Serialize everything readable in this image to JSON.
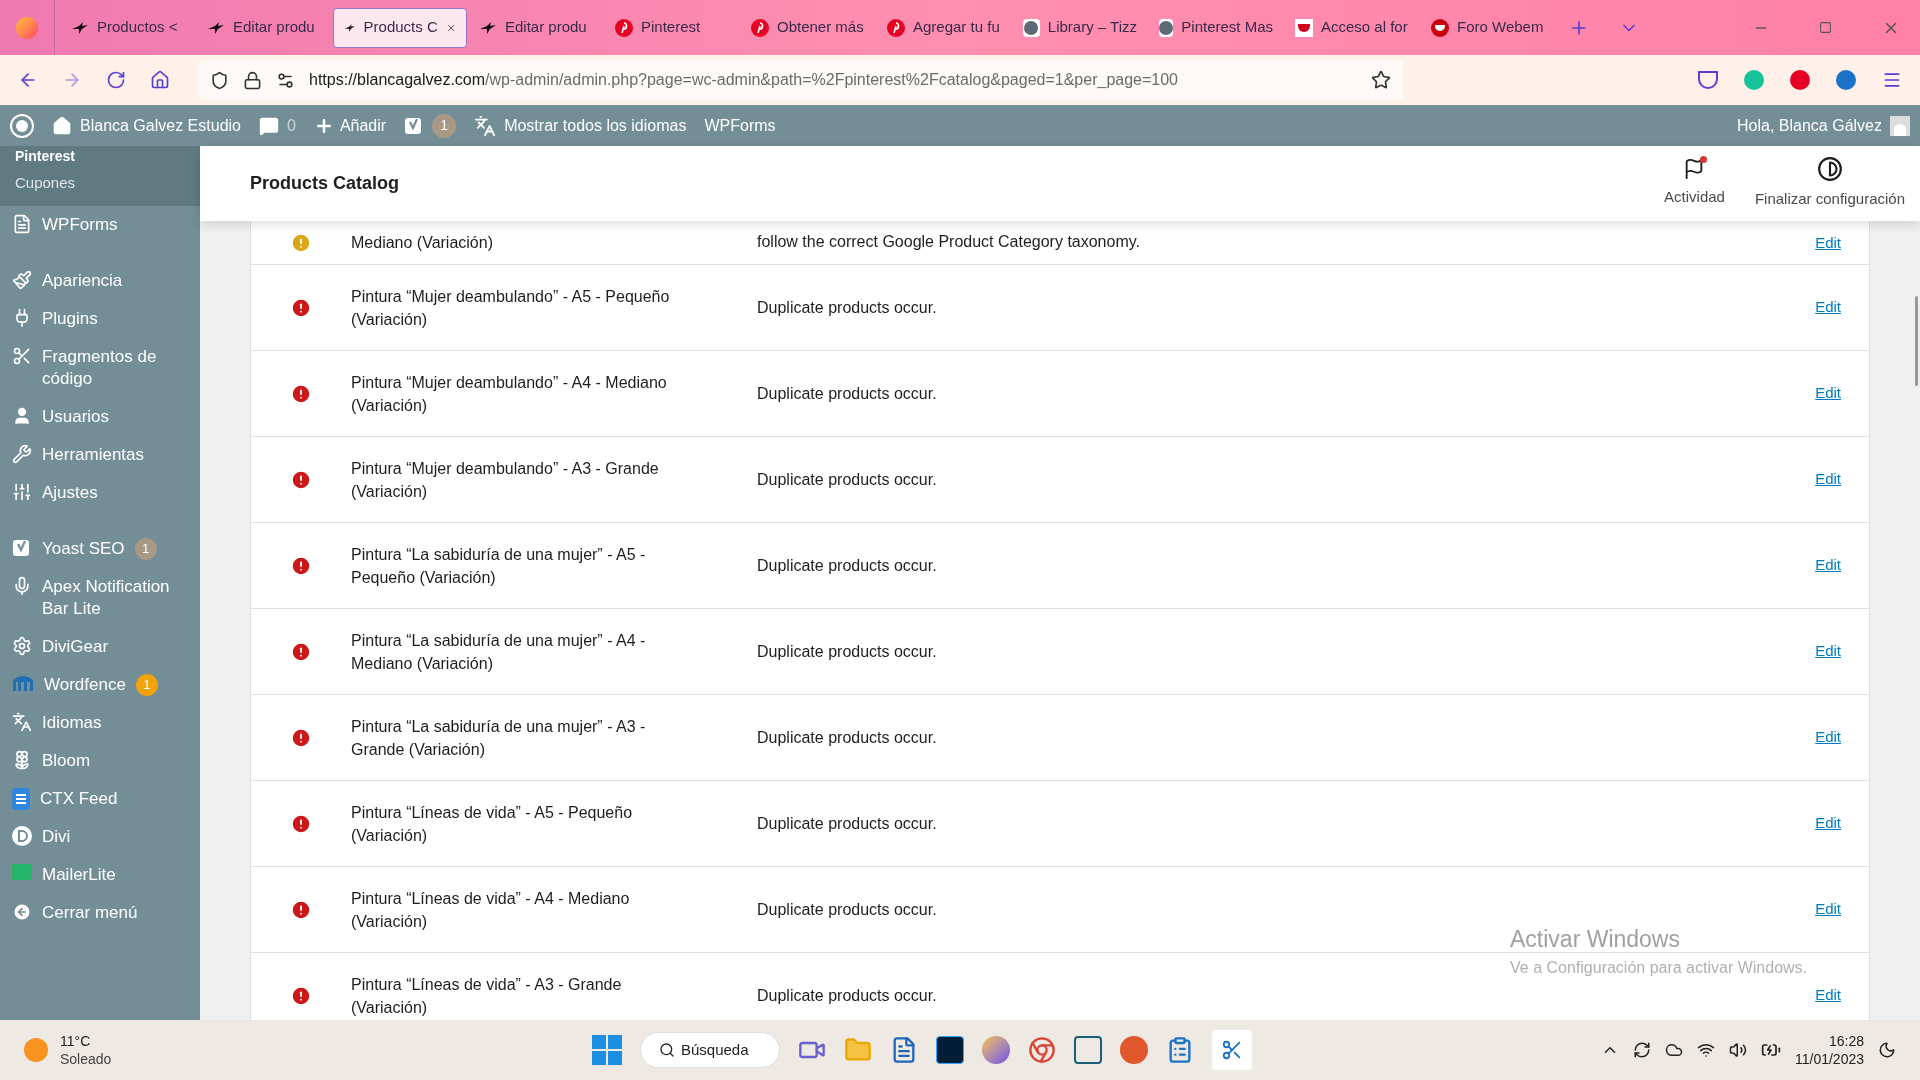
{
  "browser": {
    "tabs": [
      {
        "label": "Productos <",
        "kind": "bird",
        "selected": false
      },
      {
        "label": "Editar produ",
        "kind": "bird",
        "selected": false
      },
      {
        "label": "Products C",
        "kind": "bird",
        "selected": true
      },
      {
        "label": "Editar produ",
        "kind": "bird",
        "selected": false
      },
      {
        "label": "Pinterest",
        "kind": "pin",
        "selected": false
      },
      {
        "label": "Obtener más",
        "kind": "pin",
        "selected": false
      },
      {
        "label": "Agregar tu fu",
        "kind": "pin",
        "selected": false
      },
      {
        "label": "Library – Tizz",
        "kind": "disc",
        "selected": false
      },
      {
        "label": "Pinterest Mas",
        "kind": "disc",
        "selected": false
      },
      {
        "label": "Acceso al for",
        "kind": "square",
        "selected": false
      },
      {
        "label": "Foro Webem",
        "kind": "round",
        "selected": false
      }
    ],
    "url_host": "https://blancagalvez.com",
    "url_path": "/wp-admin/admin.php?page=wc-admin&path=%2Fpinterest%2Fcatalog&paged=1&per_page=100"
  },
  "admin_bar": {
    "site": "Blanca Galvez Estudio",
    "comments": "0",
    "add": "Añadir",
    "yoast_count": "1",
    "languages": "Mostrar todos los idiomas",
    "wpforms": "WPForms",
    "greeting": "Hola, Blanca Gálvez"
  },
  "sidebar": {
    "submenu_cut": "Pinterest",
    "submenu": [
      "Cupones"
    ],
    "groups": [
      [
        {
          "label": "WPForms",
          "kind": "form"
        }
      ],
      [
        {
          "label": "Apariencia",
          "kind": "brush"
        },
        {
          "label": "Plugins",
          "kind": "plug"
        },
        {
          "label": "Fragmentos de código",
          "kind": "scissors"
        },
        {
          "label": "Usuarios",
          "kind": "user"
        },
        {
          "label": "Herramientas",
          "kind": "wrench"
        },
        {
          "label": "Ajustes",
          "kind": "sliders"
        }
      ],
      [
        {
          "label": "Yoast SEO",
          "kind": "yoast",
          "badge": "1",
          "color": "#a89985"
        },
        {
          "label": "Apex Notification Bar Lite",
          "kind": "mic"
        },
        {
          "label": "DiviGear",
          "kind": "gear"
        },
        {
          "label": "Wordfence",
          "kind": "wordfence",
          "badge": "1",
          "color": "#f0a30a"
        },
        {
          "label": "Idiomas",
          "kind": "languages"
        },
        {
          "label": "Bloom",
          "kind": "bloom"
        },
        {
          "label": "CTX Feed",
          "kind": "doc"
        },
        {
          "label": "Divi",
          "kind": "divi"
        },
        {
          "label": "MailerLite",
          "kind": "flag"
        },
        {
          "label": "Cerrar menú",
          "kind": "collapse"
        }
      ]
    ]
  },
  "header": {
    "title": "Products Catalog",
    "actions": [
      {
        "label": "Actividad",
        "kind": "flag",
        "notify": true
      },
      {
        "label": "Finalizar configuración",
        "kind": "contrast",
        "notify": false
      }
    ]
  },
  "issues": {
    "rows": [
      {
        "kind": "warning",
        "product": "Mediano (Variación)",
        "issue": "follow the correct Google Product Category taxonomy.",
        "action": "Edit"
      },
      {
        "kind": "error",
        "product": "Pintura “Mujer deambulando” - A5 - Pequeño (Variación)",
        "issue": "Duplicate products occur.",
        "action": "Edit"
      },
      {
        "kind": "error",
        "product": "Pintura “Mujer deambulando” - A4 - Mediano (Variación)",
        "issue": "Duplicate products occur.",
        "action": "Edit"
      },
      {
        "kind": "error",
        "product": "Pintura “Mujer deambulando” - A3 - Grande (Variación)",
        "issue": "Duplicate products occur.",
        "action": "Edit"
      },
      {
        "kind": "error",
        "product": "Pintura “La sabiduría de una mujer” - A5 - Pequeño (Variación)",
        "issue": "Duplicate products occur.",
        "action": "Edit"
      },
      {
        "kind": "error",
        "product": "Pintura “La sabiduría de una mujer” - A4 - Mediano (Variación)",
        "issue": "Duplicate products occur.",
        "action": "Edit"
      },
      {
        "kind": "error",
        "product": "Pintura “La sabiduría de una mujer” - A3 - Grande (Variación)",
        "issue": "Duplicate products occur.",
        "action": "Edit"
      },
      {
        "kind": "error",
        "product": "Pintura “Líneas de vida” - A5 - Pequeño (Variación)",
        "issue": "Duplicate products occur.",
        "action": "Edit"
      },
      {
        "kind": "error",
        "product": "Pintura “Líneas de vida” - A4 - Mediano (Variación)",
        "issue": "Duplicate products occur.",
        "action": "Edit"
      },
      {
        "kind": "error",
        "product": "Pintura “Líneas de vida” - A3 - Grande (Variación)",
        "issue": "Duplicate products occur.",
        "action": "Edit"
      }
    ]
  },
  "activation": {
    "title": "Activar Windows",
    "hint": "Ve a Configuración para activar Windows."
  },
  "taskbar": {
    "temperature": "11°C",
    "weather": "Soleado",
    "search": "Búsqueda",
    "time": "16:28",
    "date": "11/01/2023"
  }
}
